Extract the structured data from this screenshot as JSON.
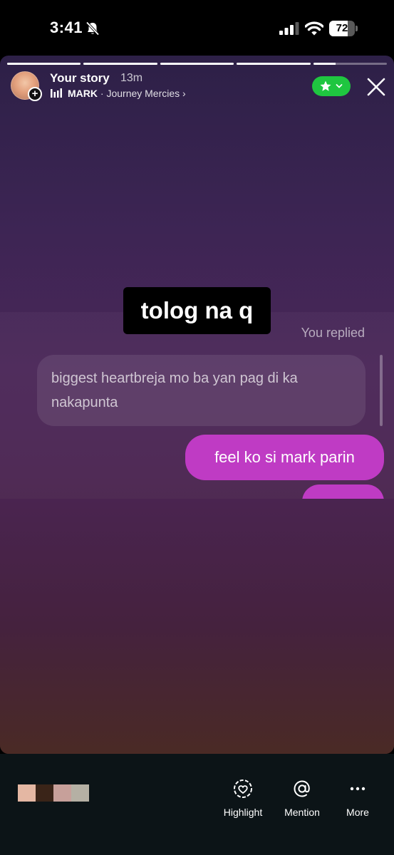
{
  "status_bar": {
    "time": "3:41",
    "silent_mode_icon": "bell-slash-icon",
    "signal_icon": "cellular-signal-icon",
    "wifi_icon": "wifi-icon",
    "battery_percent": "72",
    "battery_level": 0.72
  },
  "story": {
    "progress_segments": [
      1,
      1,
      1,
      1,
      0.3
    ],
    "header": {
      "title": "Your story",
      "time": "13m",
      "music_artist": "MARK",
      "music_separator": " · ",
      "music_song": "Journey Mercies ›",
      "avatar_badge": "+",
      "close_friends_icon": "star-icon",
      "close_icon": "close-icon"
    },
    "caption": "tolog na q",
    "thread": {
      "reply_label": "You replied",
      "received_message": "biggest heartbreja mo ba yan pag di ka nakapunta",
      "sent_message": "feel ko si mark parin"
    },
    "colors": {
      "sent_bubble": "#bf3bc4",
      "close_friends_green": "#1fc640"
    }
  },
  "bottom_bar": {
    "swatches": [
      "#e4b7a3",
      "#3a2418",
      "#c7a09a",
      "#b5b0a4"
    ],
    "actions": [
      {
        "label": "Highlight",
        "icon": "heart-circle-icon"
      },
      {
        "label": "Mention",
        "icon": "at-icon"
      },
      {
        "label": "More",
        "icon": "more-dots-icon"
      }
    ]
  }
}
